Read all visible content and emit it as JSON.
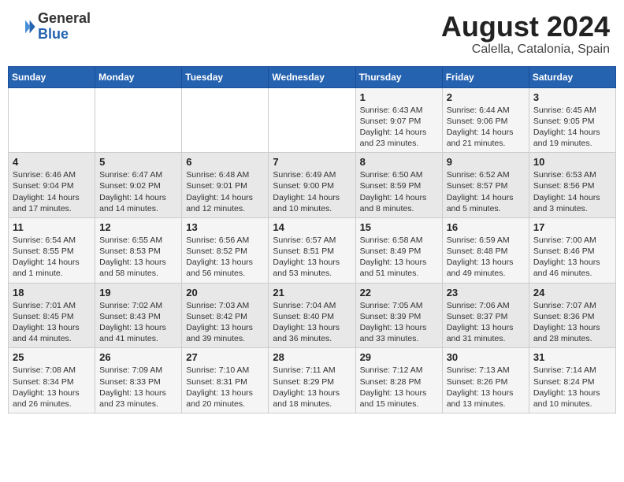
{
  "header": {
    "logo_general": "General",
    "logo_blue": "Blue",
    "month_year": "August 2024",
    "location": "Calella, Catalonia, Spain"
  },
  "days_of_week": [
    "Sunday",
    "Monday",
    "Tuesday",
    "Wednesday",
    "Thursday",
    "Friday",
    "Saturday"
  ],
  "weeks": [
    [
      {
        "day": "",
        "content": ""
      },
      {
        "day": "",
        "content": ""
      },
      {
        "day": "",
        "content": ""
      },
      {
        "day": "",
        "content": ""
      },
      {
        "day": "1",
        "content": "Sunrise: 6:43 AM\nSunset: 9:07 PM\nDaylight: 14 hours\nand 23 minutes."
      },
      {
        "day": "2",
        "content": "Sunrise: 6:44 AM\nSunset: 9:06 PM\nDaylight: 14 hours\nand 21 minutes."
      },
      {
        "day": "3",
        "content": "Sunrise: 6:45 AM\nSunset: 9:05 PM\nDaylight: 14 hours\nand 19 minutes."
      }
    ],
    [
      {
        "day": "4",
        "content": "Sunrise: 6:46 AM\nSunset: 9:04 PM\nDaylight: 14 hours\nand 17 minutes."
      },
      {
        "day": "5",
        "content": "Sunrise: 6:47 AM\nSunset: 9:02 PM\nDaylight: 14 hours\nand 14 minutes."
      },
      {
        "day": "6",
        "content": "Sunrise: 6:48 AM\nSunset: 9:01 PM\nDaylight: 14 hours\nand 12 minutes."
      },
      {
        "day": "7",
        "content": "Sunrise: 6:49 AM\nSunset: 9:00 PM\nDaylight: 14 hours\nand 10 minutes."
      },
      {
        "day": "8",
        "content": "Sunrise: 6:50 AM\nSunset: 8:59 PM\nDaylight: 14 hours\nand 8 minutes."
      },
      {
        "day": "9",
        "content": "Sunrise: 6:52 AM\nSunset: 8:57 PM\nDaylight: 14 hours\nand 5 minutes."
      },
      {
        "day": "10",
        "content": "Sunrise: 6:53 AM\nSunset: 8:56 PM\nDaylight: 14 hours\nand 3 minutes."
      }
    ],
    [
      {
        "day": "11",
        "content": "Sunrise: 6:54 AM\nSunset: 8:55 PM\nDaylight: 14 hours\nand 1 minute."
      },
      {
        "day": "12",
        "content": "Sunrise: 6:55 AM\nSunset: 8:53 PM\nDaylight: 13 hours\nand 58 minutes."
      },
      {
        "day": "13",
        "content": "Sunrise: 6:56 AM\nSunset: 8:52 PM\nDaylight: 13 hours\nand 56 minutes."
      },
      {
        "day": "14",
        "content": "Sunrise: 6:57 AM\nSunset: 8:51 PM\nDaylight: 13 hours\nand 53 minutes."
      },
      {
        "day": "15",
        "content": "Sunrise: 6:58 AM\nSunset: 8:49 PM\nDaylight: 13 hours\nand 51 minutes."
      },
      {
        "day": "16",
        "content": "Sunrise: 6:59 AM\nSunset: 8:48 PM\nDaylight: 13 hours\nand 49 minutes."
      },
      {
        "day": "17",
        "content": "Sunrise: 7:00 AM\nSunset: 8:46 PM\nDaylight: 13 hours\nand 46 minutes."
      }
    ],
    [
      {
        "day": "18",
        "content": "Sunrise: 7:01 AM\nSunset: 8:45 PM\nDaylight: 13 hours\nand 44 minutes."
      },
      {
        "day": "19",
        "content": "Sunrise: 7:02 AM\nSunset: 8:43 PM\nDaylight: 13 hours\nand 41 minutes."
      },
      {
        "day": "20",
        "content": "Sunrise: 7:03 AM\nSunset: 8:42 PM\nDaylight: 13 hours\nand 39 minutes."
      },
      {
        "day": "21",
        "content": "Sunrise: 7:04 AM\nSunset: 8:40 PM\nDaylight: 13 hours\nand 36 minutes."
      },
      {
        "day": "22",
        "content": "Sunrise: 7:05 AM\nSunset: 8:39 PM\nDaylight: 13 hours\nand 33 minutes."
      },
      {
        "day": "23",
        "content": "Sunrise: 7:06 AM\nSunset: 8:37 PM\nDaylight: 13 hours\nand 31 minutes."
      },
      {
        "day": "24",
        "content": "Sunrise: 7:07 AM\nSunset: 8:36 PM\nDaylight: 13 hours\nand 28 minutes."
      }
    ],
    [
      {
        "day": "25",
        "content": "Sunrise: 7:08 AM\nSunset: 8:34 PM\nDaylight: 13 hours\nand 26 minutes."
      },
      {
        "day": "26",
        "content": "Sunrise: 7:09 AM\nSunset: 8:33 PM\nDaylight: 13 hours\nand 23 minutes."
      },
      {
        "day": "27",
        "content": "Sunrise: 7:10 AM\nSunset: 8:31 PM\nDaylight: 13 hours\nand 20 minutes."
      },
      {
        "day": "28",
        "content": "Sunrise: 7:11 AM\nSunset: 8:29 PM\nDaylight: 13 hours\nand 18 minutes."
      },
      {
        "day": "29",
        "content": "Sunrise: 7:12 AM\nSunset: 8:28 PM\nDaylight: 13 hours\nand 15 minutes."
      },
      {
        "day": "30",
        "content": "Sunrise: 7:13 AM\nSunset: 8:26 PM\nDaylight: 13 hours\nand 13 minutes."
      },
      {
        "day": "31",
        "content": "Sunrise: 7:14 AM\nSunset: 8:24 PM\nDaylight: 13 hours\nand 10 minutes."
      }
    ]
  ]
}
